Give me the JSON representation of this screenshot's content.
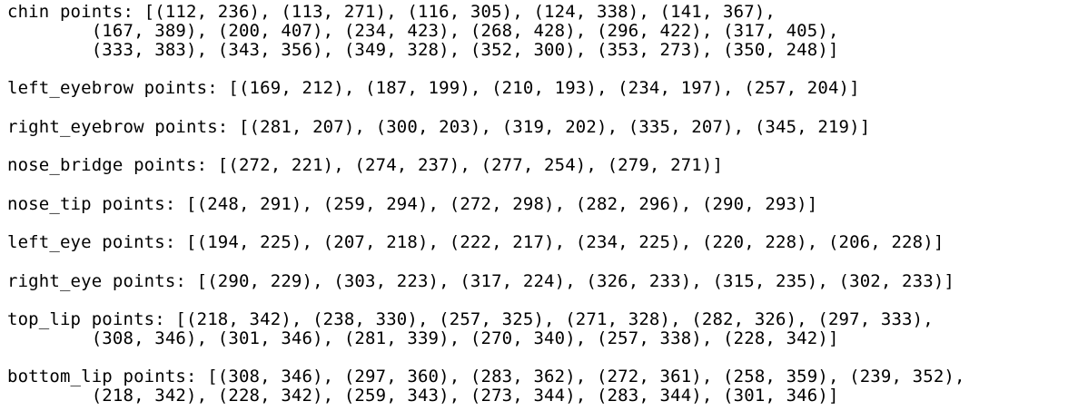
{
  "console": {
    "blocks": [
      {
        "lines": [
          "chin points: [(112, 236), (113, 271), (116, 305), (124, 338), (141, 367),",
          "        (167, 389), (200, 407), (234, 423), (268, 428), (296, 422), (317, 405),",
          "        (333, 383), (343, 356), (349, 328), (352, 300), (353, 273), (350, 248)]"
        ]
      },
      {
        "lines": [
          "left_eyebrow points: [(169, 212), (187, 199), (210, 193), (234, 197), (257, 204)]"
        ]
      },
      {
        "lines": [
          "right_eyebrow points: [(281, 207), (300, 203), (319, 202), (335, 207), (345, 219)]"
        ]
      },
      {
        "lines": [
          "nose_bridge points: [(272, 221), (274, 237), (277, 254), (279, 271)]"
        ]
      },
      {
        "lines": [
          "nose_tip points: [(248, 291), (259, 294), (272, 298), (282, 296), (290, 293)]"
        ]
      },
      {
        "lines": [
          "left_eye points: [(194, 225), (207, 218), (222, 217), (234, 225), (220, 228), (206, 228)]"
        ]
      },
      {
        "lines": [
          "right_eye points: [(290, 229), (303, 223), (317, 224), (326, 233), (315, 235), (302, 233)]"
        ]
      },
      {
        "lines": [
          "top_lip points: [(218, 342), (238, 330), (257, 325), (271, 328), (282, 326), (297, 333),",
          "        (308, 346), (301, 346), (281, 339), (270, 340), (257, 338), (228, 342)]"
        ]
      },
      {
        "lines": [
          "bottom_lip points: [(308, 346), (297, 360), (283, 362), (272, 361), (258, 359), (239, 352),",
          "        (218, 342), (228, 342), (259, 343), (273, 344), (283, 344), (301, 346)]"
        ]
      }
    ]
  }
}
